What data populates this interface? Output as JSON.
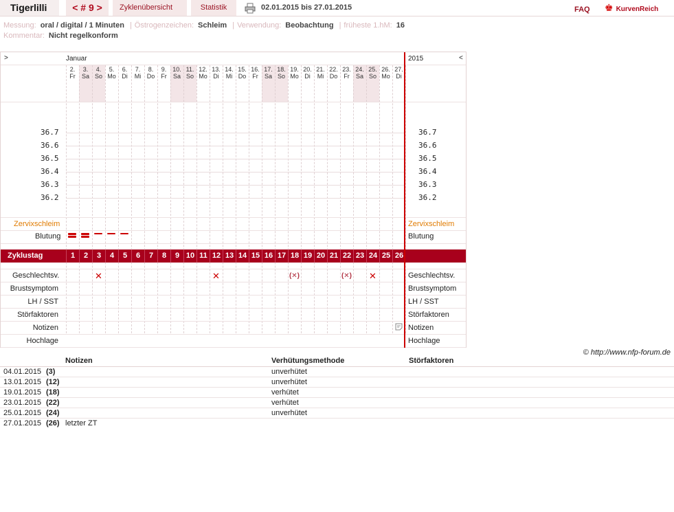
{
  "topbar": {
    "user": "Tigerlilli",
    "cycle_nav": "< # 9 >",
    "overview": "Zyklenübersicht",
    "stats": "Statistik",
    "print_icon": "printer-icon",
    "range": "02.01.2015 bis 27.01.2015",
    "faq": "FAQ",
    "logo": "KurvenReich",
    "logo_icon": "crown-icon"
  },
  "meta": {
    "messung_label": "Messung:",
    "messung": "oral / digital / 1 Minuten",
    "oestrogen_label": "Östrogenzeichen:",
    "oestrogen": "Schleim",
    "verwendung_label": "Verwendung:",
    "verwendung": "Beobachtung",
    "fruehe_label": "früheste 1.hM:",
    "fruehe": "16",
    "kommentar_label": "Kommentar:",
    "kommentar": "Nicht regelkonform"
  },
  "chart": {
    "nav_left": ">",
    "nav_right": "<",
    "month": "Januar",
    "year": "2015",
    "days": [
      {
        "d": "2.",
        "w": "Fr"
      },
      {
        "d": "3.",
        "w": "Sa"
      },
      {
        "d": "4.",
        "w": "So"
      },
      {
        "d": "5.",
        "w": "Mo"
      },
      {
        "d": "6.",
        "w": "Di"
      },
      {
        "d": "7.",
        "w": "Mi"
      },
      {
        "d": "8.",
        "w": "Do"
      },
      {
        "d": "9.",
        "w": "Fr"
      },
      {
        "d": "10.",
        "w": "Sa"
      },
      {
        "d": "11.",
        "w": "So"
      },
      {
        "d": "12.",
        "w": "Mo"
      },
      {
        "d": "13.",
        "w": "Di"
      },
      {
        "d": "14.",
        "w": "Mi"
      },
      {
        "d": "15.",
        "w": "Do"
      },
      {
        "d": "16.",
        "w": "Fr"
      },
      {
        "d": "17.",
        "w": "Sa"
      },
      {
        "d": "18.",
        "w": "So"
      },
      {
        "d": "19.",
        "w": "Mo"
      },
      {
        "d": "20.",
        "w": "Di"
      },
      {
        "d": "21.",
        "w": "Mi"
      },
      {
        "d": "22.",
        "w": "Do"
      },
      {
        "d": "23.",
        "w": "Fr"
      },
      {
        "d": "24.",
        "w": "Sa"
      },
      {
        "d": "25.",
        "w": "So"
      },
      {
        "d": "26.",
        "w": "Mo"
      },
      {
        "d": "27.",
        "w": "Di"
      }
    ],
    "weekend_ranges": [
      [
        1,
        2
      ],
      [
        8,
        9
      ],
      [
        15,
        16
      ],
      [
        22,
        23
      ]
    ],
    "temp_labels": [
      "36.7",
      "36.6",
      "36.5",
      "36.4",
      "36.3",
      "36.2"
    ],
    "zervix_label": "Zervixschleim",
    "zervix_color": "#e07b00",
    "blutung_label": "Blutung",
    "bleeding": [
      {
        "day": 1,
        "level": "strong"
      },
      {
        "day": 2,
        "level": "strong"
      },
      {
        "day": 3,
        "level": "light"
      },
      {
        "day": 4,
        "level": "light"
      },
      {
        "day": 5,
        "level": "light"
      }
    ],
    "zyklustag_label": "Zyklustag",
    "cycle_days": [
      "1",
      "2",
      "3",
      "4",
      "5",
      "6",
      "7",
      "8",
      "9",
      "10",
      "11",
      "12",
      "13",
      "14",
      "15",
      "16",
      "17",
      "18",
      "19",
      "20",
      "21",
      "22",
      "23",
      "24",
      "25",
      "26"
    ],
    "geschlechtsv_label": "Geschlechtsv.",
    "intercourse": [
      {
        "cycle_day": 3,
        "mark": "✕",
        "protected": false
      },
      {
        "cycle_day": 12,
        "mark": "✕",
        "protected": false
      },
      {
        "cycle_day": 18,
        "mark": "(✕)",
        "protected": true
      },
      {
        "cycle_day": 22,
        "mark": "(✕)",
        "protected": true
      },
      {
        "cycle_day": 24,
        "mark": "✕",
        "protected": false
      }
    ],
    "bottom_rows": [
      "Brustsymptom",
      "LH / SST",
      "Störfaktoren",
      "Notizen",
      "Hochlage"
    ],
    "note_icon_cycle_day": 26,
    "note_icon": "note-icon",
    "accent": "#a8001c"
  },
  "copyright": "© http://www.nfp-forum.de",
  "notes_table": {
    "headers": [
      "Notizen",
      "Verhütungsmethode",
      "Störfaktoren"
    ],
    "rows": [
      {
        "date": "04.01.2015",
        "cd": "(3)",
        "note": "",
        "method": "unverhütet",
        "stoer": ""
      },
      {
        "date": "13.01.2015",
        "cd": "(12)",
        "note": "",
        "method": "unverhütet",
        "stoer": ""
      },
      {
        "date": "19.01.2015",
        "cd": "(18)",
        "note": "",
        "method": "verhütet",
        "stoer": ""
      },
      {
        "date": "23.01.2015",
        "cd": "(22)",
        "note": "",
        "method": "verhütet",
        "stoer": ""
      },
      {
        "date": "25.01.2015",
        "cd": "(24)",
        "note": "",
        "method": "unverhütet",
        "stoer": ""
      },
      {
        "date": "27.01.2015",
        "cd": "(26)",
        "note": "letzter ZT",
        "method": "",
        "stoer": ""
      }
    ]
  }
}
